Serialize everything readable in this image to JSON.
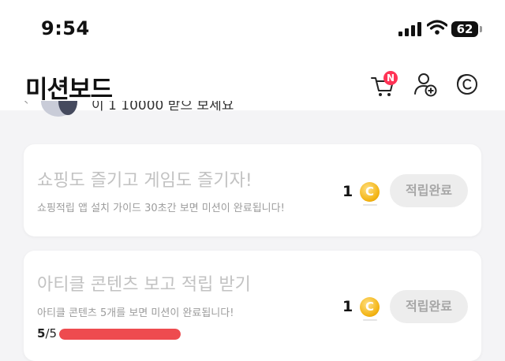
{
  "status_bar": {
    "time": "9:54",
    "battery": "62"
  },
  "header": {
    "title": "미션보드",
    "cart_badge": "N"
  },
  "partial_row": {
    "text": "이 1 10000 받으 보세요"
  },
  "missions": [
    {
      "title": "쇼핑도 즐기고 게임도 즐기자!",
      "description": "쇼핑적립 앱 설치 가이드 30초간 보면 미션이 완료됩니다!",
      "reward": "1",
      "coin_symbol": "C",
      "button_label": "적립완료"
    },
    {
      "title": "아티클 콘텐츠 보고 적립 받기",
      "description": "아티클 콘텐츠 5개를 보면 미션이 완료됩니다!",
      "reward": "1",
      "coin_symbol": "C",
      "button_label": "적립완료",
      "progress_current": "5",
      "progress_total": "/5",
      "progress_fraction": 1.0
    }
  ],
  "colors": {
    "accent_red": "#ee4b4f",
    "coin_gold": "#f3b414",
    "badge_red": "#ff3355"
  },
  "icons": [
    "signal-icon",
    "wifi-icon",
    "battery-icon",
    "cart-icon",
    "add-user-icon",
    "coin-icon"
  ]
}
